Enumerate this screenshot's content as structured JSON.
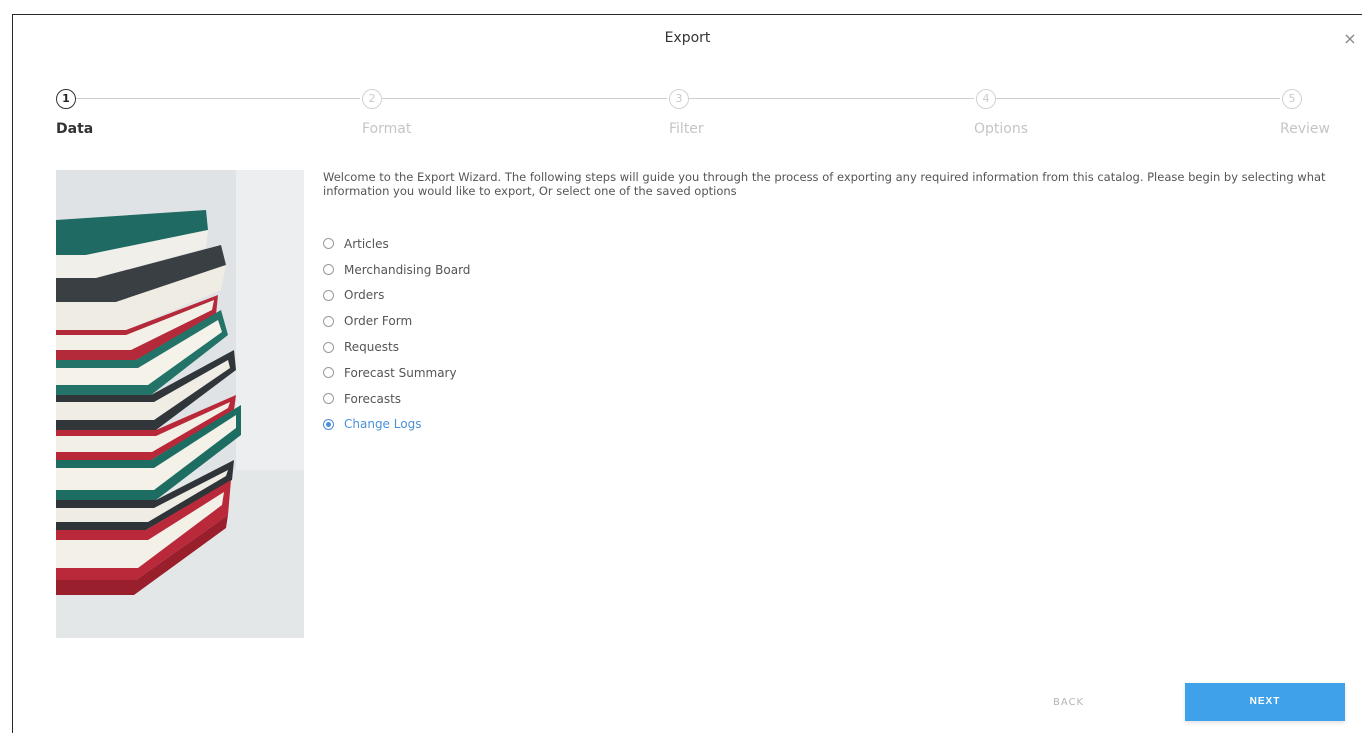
{
  "dialog": {
    "title": "Export",
    "close_icon": "×"
  },
  "steps": [
    {
      "number": "1",
      "label": "Data",
      "active": true
    },
    {
      "number": "2",
      "label": "Format",
      "active": false
    },
    {
      "number": "3",
      "label": "Filter",
      "active": false
    },
    {
      "number": "4",
      "label": "Options",
      "active": false
    },
    {
      "number": "5",
      "label": "Review",
      "active": false
    }
  ],
  "intro_text": "Welcome to the Export Wizard. The following steps will guide you through the process of exporting any required information from this catalog. Please begin by selecting what information you would like to export, Or select one of the saved options",
  "options": [
    {
      "label": "Articles",
      "selected": false
    },
    {
      "label": "Merchandising Board",
      "selected": false
    },
    {
      "label": "Orders",
      "selected": false
    },
    {
      "label": "Order Form",
      "selected": false
    },
    {
      "label": "Requests",
      "selected": false
    },
    {
      "label": "Forecast Summary",
      "selected": false
    },
    {
      "label": "Forecasts",
      "selected": false
    },
    {
      "label": "Change Logs",
      "selected": true
    }
  ],
  "footer": {
    "back_label": "BACK",
    "next_label": "NEXT"
  },
  "colors": {
    "accent": "#3ea1ea",
    "selected_text": "#4a90d9"
  }
}
